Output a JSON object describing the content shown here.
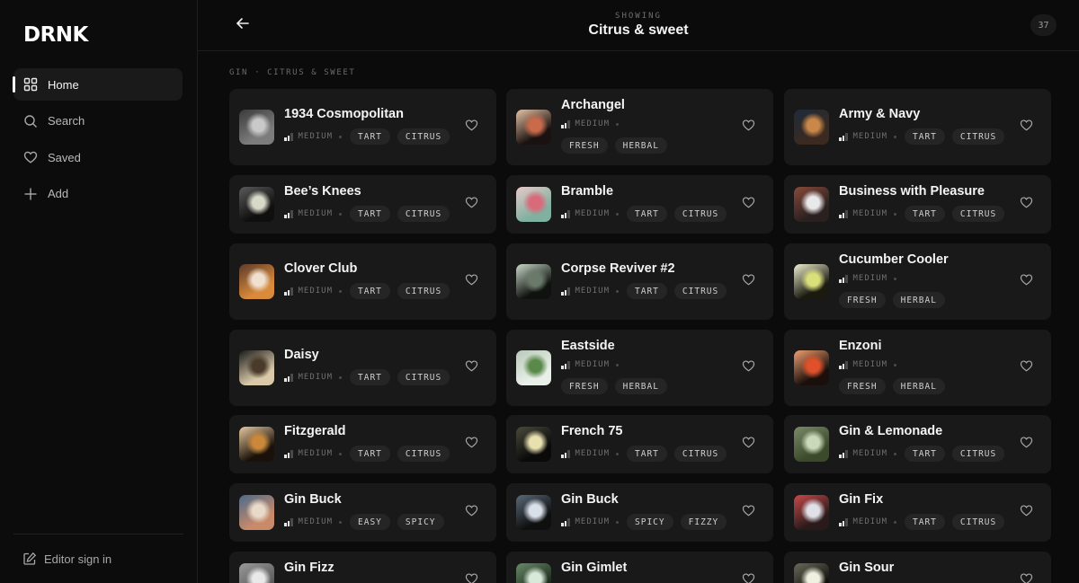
{
  "sidebar": {
    "logo": "DRNK",
    "items": [
      {
        "label": "Home",
        "icon": "grid-icon",
        "active": true
      },
      {
        "label": "Search",
        "icon": "search-icon"
      },
      {
        "label": "Saved",
        "icon": "heart-icon"
      },
      {
        "label": "Add",
        "icon": "plus-icon"
      }
    ],
    "editor_label": "Editor sign in"
  },
  "header": {
    "showing_label": "SHOWING",
    "title": "Citrus & sweet",
    "count": "37"
  },
  "breadcrumb": "GIN · CITRUS & SWEET",
  "colors": {
    "background": "#0b0b0b",
    "card": "#191919",
    "tag": "#252525",
    "text": "#f4f4f4"
  },
  "drinks": [
    {
      "name": "1934 Cosmopolitan",
      "strength": "MEDIUM",
      "tags": [
        "TART",
        "CITRUS"
      ],
      "thumb": [
        "#7c7c7c",
        "#c9c9c9",
        "#3a3a3a"
      ]
    },
    {
      "name": "Archangel",
      "strength": "MEDIUM",
      "tags": [
        "FRESH",
        "HERBAL"
      ],
      "thumb": [
        "#1a1210",
        "#c96a4a",
        "#e7c2a6"
      ]
    },
    {
      "name": "Army & Navy",
      "strength": "MEDIUM",
      "tags": [
        "TART",
        "CITRUS"
      ],
      "thumb": [
        "#3a2a20",
        "#c9884a",
        "#1e2a3a"
      ]
    },
    {
      "name": "Bee’s Knees",
      "strength": "MEDIUM",
      "tags": [
        "TART",
        "CITRUS"
      ],
      "thumb": [
        "#0f0f0f",
        "#d9d9c9",
        "#5a5a5a"
      ]
    },
    {
      "name": "Bramble",
      "strength": "MEDIUM",
      "tags": [
        "TART",
        "CITRUS"
      ],
      "thumb": [
        "#7fb0a0",
        "#d96a7a",
        "#e9c9c9"
      ]
    },
    {
      "name": "Business with Pleasure",
      "strength": "MEDIUM",
      "tags": [
        "TART",
        "CITRUS"
      ],
      "thumb": [
        "#2a2020",
        "#e9e9e9",
        "#8a4a3a"
      ]
    },
    {
      "name": "Clover Club",
      "strength": "MEDIUM",
      "tags": [
        "TART",
        "CITRUS"
      ],
      "thumb": [
        "#d98a3a",
        "#f0e0d0",
        "#5a3a2a"
      ]
    },
    {
      "name": "Corpse Reviver #2",
      "strength": "MEDIUM",
      "tags": [
        "TART",
        "CITRUS"
      ],
      "thumb": [
        "#0f120f",
        "#6a7a6a",
        "#c9d9c9"
      ]
    },
    {
      "name": "Cucumber Cooler",
      "strength": "MEDIUM",
      "tags": [
        "FRESH",
        "HERBAL"
      ],
      "thumb": [
        "#1a1a10",
        "#d9e07a",
        "#f0f0d0"
      ]
    },
    {
      "name": "Daisy",
      "strength": "MEDIUM",
      "tags": [
        "TART",
        "CITRUS"
      ],
      "thumb": [
        "#d9c9a9",
        "#4a3a2a",
        "#1a1a1a"
      ]
    },
    {
      "name": "Eastside",
      "strength": "MEDIUM",
      "tags": [
        "FRESH",
        "HERBAL"
      ],
      "thumb": [
        "#e9efe9",
        "#5a8a4a",
        "#b9c9b9"
      ]
    },
    {
      "name": "Enzoni",
      "strength": "MEDIUM",
      "tags": [
        "FRESH",
        "HERBAL"
      ],
      "thumb": [
        "#1a0f0a",
        "#e0502a",
        "#f0a070"
      ]
    },
    {
      "name": "Fitzgerald",
      "strength": "MEDIUM",
      "tags": [
        "TART",
        "CITRUS"
      ],
      "thumb": [
        "#1a120a",
        "#c9883a",
        "#e9c9a0"
      ]
    },
    {
      "name": "French 75",
      "strength": "MEDIUM",
      "tags": [
        "TART",
        "CITRUS"
      ],
      "thumb": [
        "#0a0a0a",
        "#e9e0b0",
        "#4a4a3a"
      ]
    },
    {
      "name": "Gin & Lemonade",
      "strength": "MEDIUM",
      "tags": [
        "TART",
        "CITRUS"
      ],
      "thumb": [
        "#3a4a2a",
        "#c9d9b9",
        "#7a8a6a"
      ]
    },
    {
      "name": "Gin Buck",
      "strength": "MEDIUM",
      "tags": [
        "EASY",
        "SPICY"
      ],
      "thumb": [
        "#c98a6a",
        "#e9d9c9",
        "#4a6a8a"
      ]
    },
    {
      "name": "Gin Buck",
      "strength": "MEDIUM",
      "tags": [
        "SPICY",
        "FIZZY"
      ],
      "thumb": [
        "#0f0f0f",
        "#d9e0e9",
        "#5a6a7a"
      ]
    },
    {
      "name": "Gin Fix",
      "strength": "MEDIUM",
      "tags": [
        "TART",
        "CITRUS"
      ],
      "thumb": [
        "#2a1a1a",
        "#e0e0e9",
        "#c94a4a"
      ]
    },
    {
      "name": "Gin Fizz",
      "strength": "",
      "tags": [],
      "thumb": [
        "#5a5a5a",
        "#e9e9e9",
        "#9a9a9a"
      ]
    },
    {
      "name": "Gin Gimlet",
      "strength": "",
      "tags": [],
      "thumb": [
        "#1a2a1a",
        "#d9e9d9",
        "#6a8a6a"
      ]
    },
    {
      "name": "Gin Sour",
      "strength": "",
      "tags": [],
      "thumb": [
        "#0f0f0a",
        "#f0f0e0",
        "#6a6a5a"
      ]
    }
  ]
}
